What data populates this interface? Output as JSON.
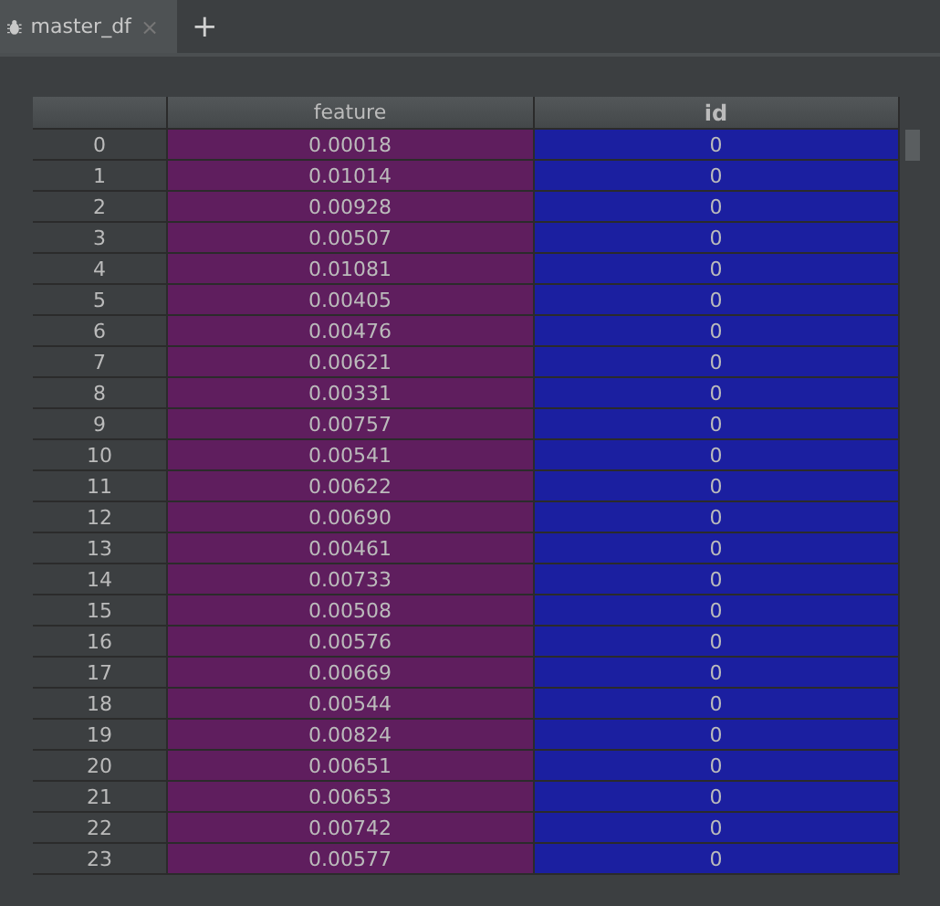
{
  "tabs": [
    {
      "label": "master_df",
      "selected": true,
      "close": "×"
    }
  ],
  "new_tab": "+",
  "table": {
    "columns": [
      {
        "label": "feature",
        "bold": false,
        "color": "#5f1e5e"
      },
      {
        "label": "id",
        "bold": true,
        "color": "#1b1fa0"
      }
    ],
    "rows": [
      {
        "index": "0",
        "cells": [
          "0.00018",
          "0"
        ]
      },
      {
        "index": "1",
        "cells": [
          "0.01014",
          "0"
        ]
      },
      {
        "index": "2",
        "cells": [
          "0.00928",
          "0"
        ]
      },
      {
        "index": "3",
        "cells": [
          "0.00507",
          "0"
        ]
      },
      {
        "index": "4",
        "cells": [
          "0.01081",
          "0"
        ]
      },
      {
        "index": "5",
        "cells": [
          "0.00405",
          "0"
        ]
      },
      {
        "index": "6",
        "cells": [
          "0.00476",
          "0"
        ]
      },
      {
        "index": "7",
        "cells": [
          "0.00621",
          "0"
        ]
      },
      {
        "index": "8",
        "cells": [
          "0.00331",
          "0"
        ]
      },
      {
        "index": "9",
        "cells": [
          "0.00757",
          "0"
        ]
      },
      {
        "index": "10",
        "cells": [
          "0.00541",
          "0"
        ]
      },
      {
        "index": "11",
        "cells": [
          "0.00622",
          "0"
        ]
      },
      {
        "index": "12",
        "cells": [
          "0.00690",
          "0"
        ]
      },
      {
        "index": "13",
        "cells": [
          "0.00461",
          "0"
        ]
      },
      {
        "index": "14",
        "cells": [
          "0.00733",
          "0"
        ]
      },
      {
        "index": "15",
        "cells": [
          "0.00508",
          "0"
        ]
      },
      {
        "index": "16",
        "cells": [
          "0.00576",
          "0"
        ]
      },
      {
        "index": "17",
        "cells": [
          "0.00669",
          "0"
        ]
      },
      {
        "index": "18",
        "cells": [
          "0.00544",
          "0"
        ]
      },
      {
        "index": "19",
        "cells": [
          "0.00824",
          "0"
        ]
      },
      {
        "index": "20",
        "cells": [
          "0.00651",
          "0"
        ]
      },
      {
        "index": "21",
        "cells": [
          "0.00653",
          "0"
        ]
      },
      {
        "index": "22",
        "cells": [
          "0.00742",
          "0"
        ]
      },
      {
        "index": "23",
        "cells": [
          "0.00577",
          "0"
        ]
      }
    ]
  }
}
